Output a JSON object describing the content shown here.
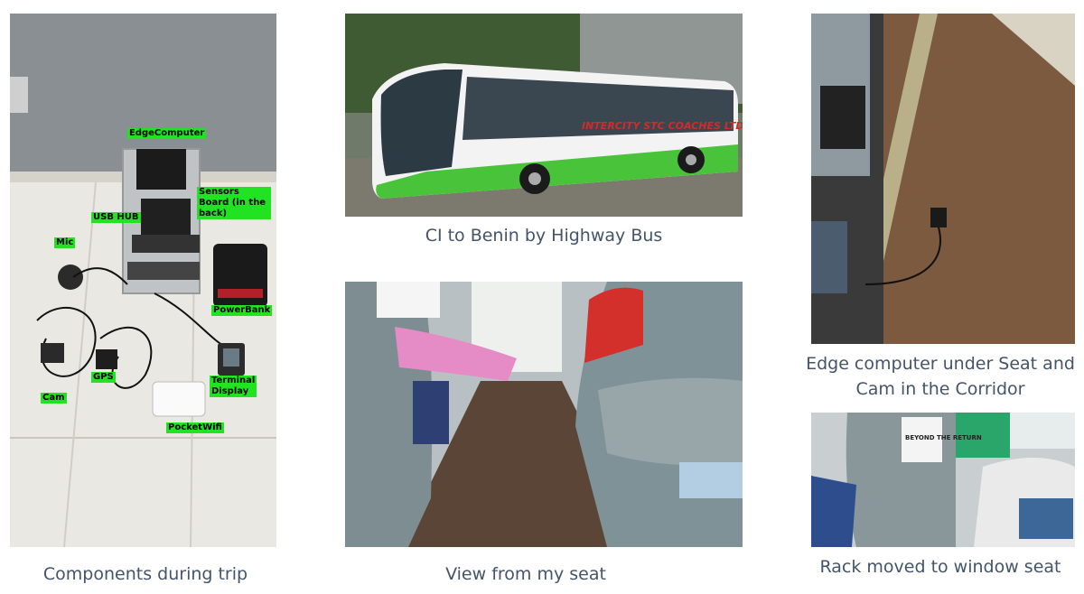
{
  "panel1": {
    "caption": "Components during trip",
    "labels": {
      "edge_computer": "EdgeComputer",
      "sensors_board": "Sensors Board (in the back)",
      "usb_hub": "USB HUB",
      "mic": "Mic",
      "powerbank": "PowerBank",
      "gps": "GPS",
      "terminal_display": "Terminal Display",
      "cam": "Cam",
      "pocketwifi": "PocketWifi"
    }
  },
  "panel2": {
    "caption": "CI to Benin by Highway Bus",
    "bus_brand": "INTERCITY STC COACHES LTD."
  },
  "panel3": {
    "caption": "View from my seat"
  },
  "panel4": {
    "caption": "Edge computer under Seat and Cam in the Corridor"
  },
  "panel5": {
    "caption": "Rack moved to window seat",
    "sign_text": "BEYOND THE RETURN"
  },
  "colors": {
    "label_bg": "#22e322",
    "caption_color": "#44546a"
  }
}
